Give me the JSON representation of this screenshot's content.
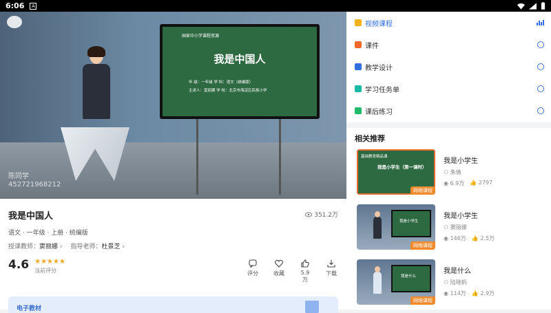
{
  "status_bar": {
    "time": "6:06",
    "notification": "A"
  },
  "video": {
    "board_source": "国家中小学课程资源",
    "board_title": "我是中国人",
    "board_line1": "年 级：一年级     学 科：语文（统编版）",
    "board_line2": "主讲人：窦丽娜     学 校：北京市海淀区民族小学",
    "watermark_name": "陈同学",
    "watermark_id": "452721968212"
  },
  "lesson": {
    "title": "我是中国人",
    "views": "351.2万",
    "meta": "语文 · 一年级 · 上册 · 统编版",
    "teacher_label": "授课教师：",
    "teacher_name": "窦丽娜",
    "guide_label": "指导老师：",
    "guide_name": "杜景芝",
    "rating": "4.6",
    "rating_label": "当前评分",
    "actions": {
      "comment": "评分",
      "favorite": "收藏",
      "likes": "5.9万",
      "download": "下载"
    },
    "ebook_label": "电子教材"
  },
  "menu": {
    "items": [
      {
        "label": "视频课程",
        "color": "#f5b21e"
      },
      {
        "label": "课件",
        "color": "#f0682c"
      },
      {
        "label": "教学设计",
        "color": "#2f6fe0"
      },
      {
        "label": "学习任务单",
        "color": "#19b9a8"
      },
      {
        "label": "课后练习",
        "color": "#1fba6b"
      }
    ]
  },
  "recommend": {
    "title": "相关推荐",
    "items": [
      {
        "title": "我是小学生",
        "author": "朱倩",
        "views": "6.9万",
        "likes": "2797",
        "tag": "网络课程",
        "board_title": "我是小学生（第一课时）",
        "board_src": "基础教育精品课"
      },
      {
        "title": "我是小学生",
        "author": "窦丽娜",
        "views": "146万",
        "likes": "2.5万",
        "tag": "网络课程",
        "board_title": "我是小学生"
      },
      {
        "title": "我是什么",
        "author": "陆晓帆",
        "views": "114万",
        "likes": "2.9万",
        "tag": "网络课程",
        "board_title": "我是什么"
      }
    ]
  }
}
